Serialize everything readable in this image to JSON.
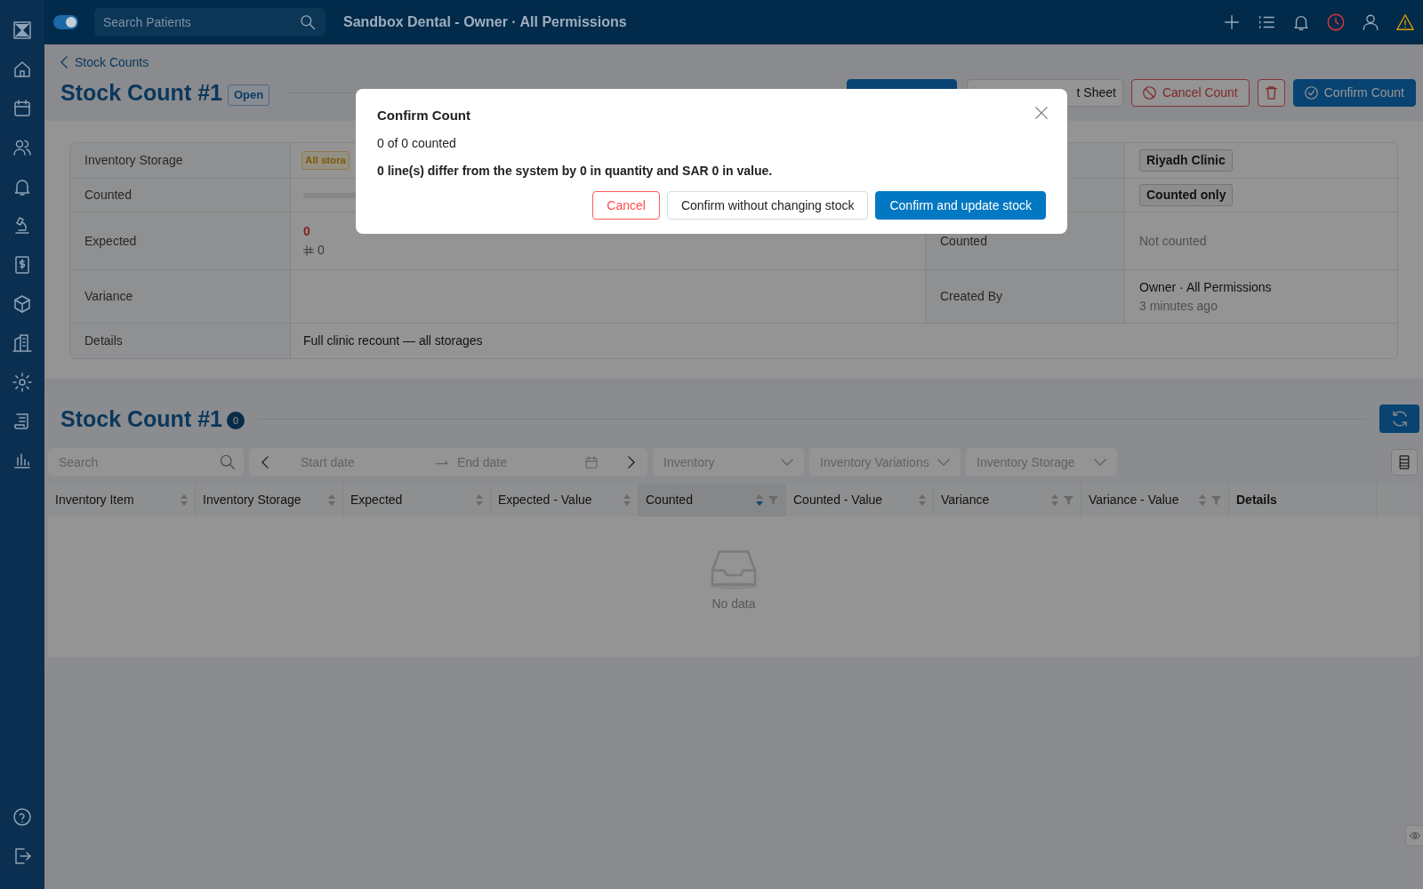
{
  "topbar": {
    "toggle_on": true,
    "search": {
      "placeholder": "Search Patients"
    },
    "title": "Sandbox Dental - Owner · All Permissions"
  },
  "breadcrumb": "Stock Counts",
  "header": {
    "title": "Stock Count #1",
    "status": "Open",
    "actions": [
      {
        "kind": "primary"
      },
      {
        "kind": "outline",
        "label": "t Sheet"
      },
      {
        "kind": "danger",
        "label": "Cancel Count"
      },
      {
        "kind": "delete"
      },
      {
        "kind": "confirm",
        "label": "Confirm Count"
      }
    ]
  },
  "details": [
    {
      "label": "Inventory Storage",
      "value": {
        "kind": "tag",
        "text": "All stora"
      },
      "right_value": {
        "kind": "tag",
        "text": "Riyadh Clinic"
      }
    },
    {
      "label": "Counted",
      "value": {
        "kind": "progress",
        "level": 0
      },
      "right_value": {
        "kind": "tag",
        "text": "Counted only"
      }
    },
    {
      "label": "Expected",
      "value": {
        "kind": "amount",
        "text": "0",
        "money": "0"
      },
      "right_label": "Counted",
      "right_value": {
        "kind": "muted",
        "text": "Not counted"
      }
    },
    {
      "label": "Variance",
      "right_label": "Created By",
      "right_value": {
        "kind": "person",
        "text": "Owner · All Permissions",
        "sub": "3 minutes ago"
      }
    },
    {
      "label": "Details",
      "value": {
        "kind": "text",
        "text": "Full clinic recount — all storages"
      }
    }
  ],
  "section": {
    "title": "Stock Count #1",
    "count": "0"
  },
  "filters": {
    "search": {
      "placeholder": "Search"
    },
    "date_range": {
      "start_placeholder": "Start date",
      "end_placeholder": "End date"
    },
    "selects": [
      {
        "placeholder": "Inventory"
      },
      {
        "placeholder": "Inventory Variations"
      },
      {
        "placeholder": "Inventory Storage"
      }
    ]
  },
  "table": {
    "columns": [
      {
        "label": "Inventory Item",
        "sorted": false,
        "filter": false
      },
      {
        "label": "Inventory Storage",
        "sorted": false,
        "filter": false
      },
      {
        "label": "Expected",
        "sorted": false,
        "filter": false
      },
      {
        "label": "Expected - Value",
        "sorted": false,
        "filter": false
      },
      {
        "label": "Counted",
        "sorted": true,
        "filter": true
      },
      {
        "label": "Counted - Value",
        "sorted": false,
        "filter": false
      },
      {
        "label": "Variance",
        "sorted": false,
        "filter": true
      },
      {
        "label": "Variance - Value",
        "sorted": false,
        "filter": true
      },
      {
        "label": "Details",
        "filter": false
      }
    ],
    "empty_text": "No data"
  },
  "modal": {
    "title": "Confirm Count",
    "progress_text": "0 of 0 counted",
    "summary": "0 line(s) differ from the system by 0 in quantity and SAR 0 in value.",
    "buttons": [
      {
        "kind": "danger",
        "label": "Cancel"
      },
      {
        "kind": "default",
        "label": "Confirm without changing stock"
      },
      {
        "kind": "primary",
        "label": "Confirm and update stock"
      }
    ]
  }
}
